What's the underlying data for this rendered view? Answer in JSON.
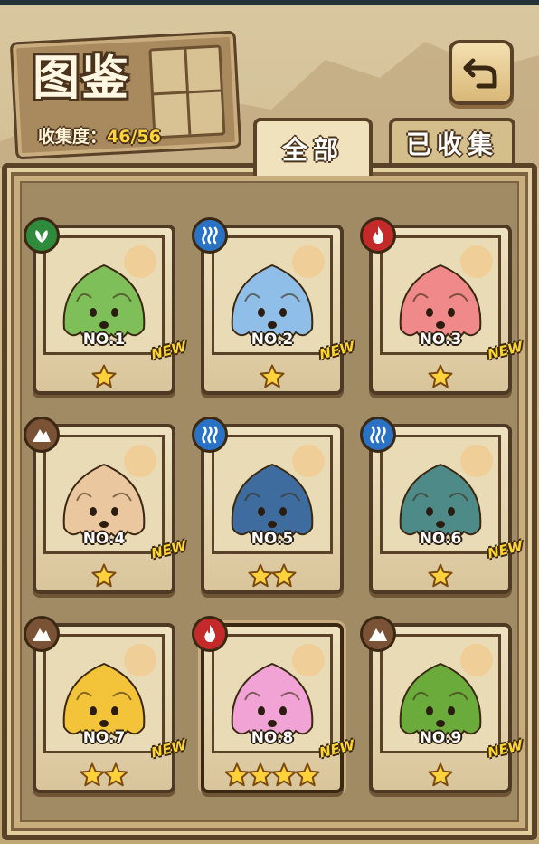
{
  "header": {
    "title": "图鉴",
    "collect_label": "收集度：",
    "collect_value": "46/56"
  },
  "tabs": [
    {
      "label": "全部",
      "active": true
    },
    {
      "label": "已收集",
      "active": false
    }
  ],
  "cards": [
    {
      "no": "NO.1",
      "element": "grass",
      "stars": 1,
      "new": "NEW",
      "color": "#7fbf5a"
    },
    {
      "no": "NO.2",
      "element": "water",
      "stars": 1,
      "new": "NEW",
      "color": "#8fbfe8"
    },
    {
      "no": "NO.3",
      "element": "fire",
      "stars": 1,
      "new": "NEW",
      "color": "#f08a8a"
    },
    {
      "no": "NO.4",
      "element": "earth",
      "stars": 1,
      "new": "NEW",
      "color": "#ebc7a0"
    },
    {
      "no": "NO.5",
      "element": "water",
      "stars": 2,
      "new": "",
      "color": "#3f6c9e"
    },
    {
      "no": "NO.6",
      "element": "water",
      "stars": 1,
      "new": "NEW",
      "color": "#4e8a88"
    },
    {
      "no": "NO.7",
      "element": "earth",
      "stars": 2,
      "new": "NEW",
      "color": "#f3c43a"
    },
    {
      "no": "NO.8",
      "element": "fire",
      "stars": 4,
      "new": "NEW",
      "color": "#f0a3d4"
    },
    {
      "no": "NO.9",
      "element": "earth",
      "stars": 1,
      "new": "NEW",
      "color": "#6aab3c"
    }
  ],
  "icons": {
    "grass": "leaf-icon",
    "water": "steam-icon",
    "fire": "flame-icon",
    "earth": "mountain-icon",
    "back": "return-arrow-icon",
    "star": "star-icon"
  }
}
